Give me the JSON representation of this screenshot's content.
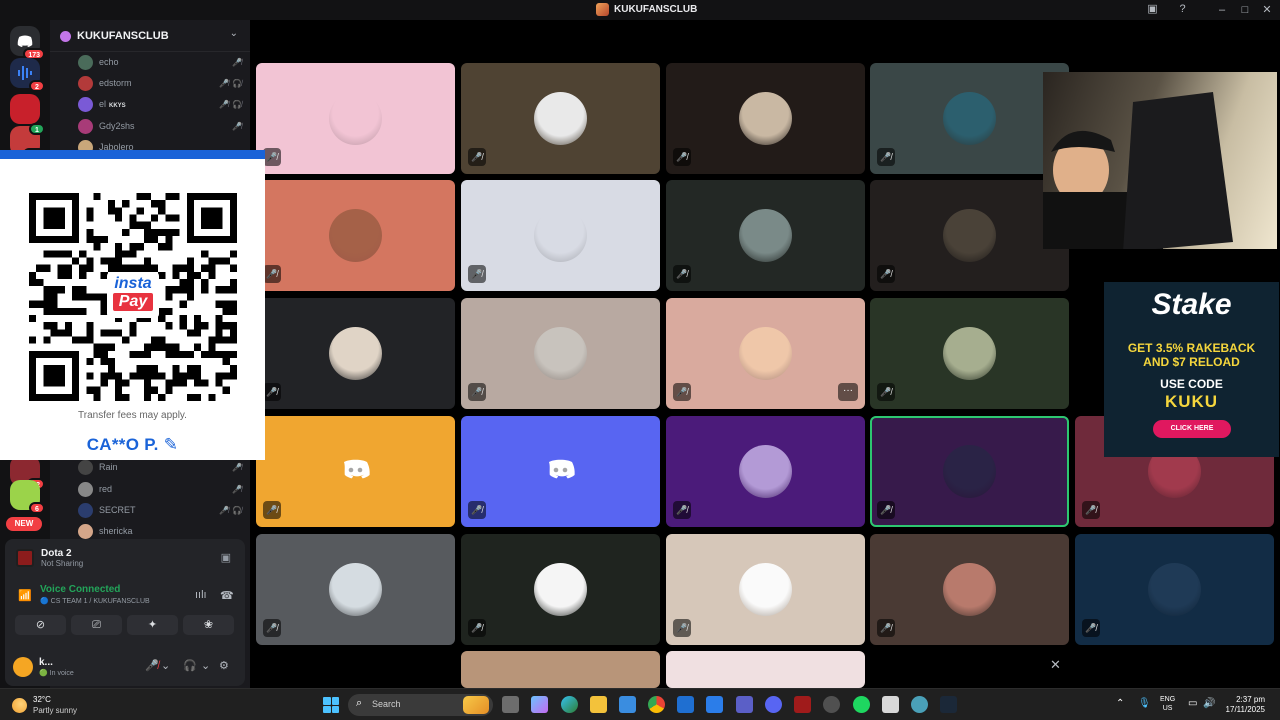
{
  "window": {
    "title": "KUKUFANSCLUB"
  },
  "rail": {
    "badges": [
      "173",
      "2",
      "1",
      "328",
      "92",
      "6"
    ],
    "new_label": "NEW"
  },
  "server": {
    "name": "KUKUFANSCLUB"
  },
  "voice_users_top": [
    {
      "name": "echo",
      "color": "#4a6b5a"
    },
    {
      "name": "edstorm",
      "color": "#b33a3a"
    },
    {
      "name": "el",
      "color": "#7a5ad6",
      "tag": "KKYS"
    },
    {
      "name": "Gdy2shs",
      "color": "#a83b78"
    },
    {
      "name": "Jabolero",
      "color": "#c9a77a"
    }
  ],
  "voice_users_bottom": [
    {
      "name": "Rain",
      "color": "#444"
    },
    {
      "name": "red",
      "color": "#888"
    },
    {
      "name": "SECRET",
      "color": "#2b3d6e"
    },
    {
      "name": "shericka",
      "color": "#d5a689"
    }
  ],
  "qr_card": {
    "logo_top": "insta",
    "logo_bottom": "Pay",
    "note": "Transfer fees may apply.",
    "recipient": "CA**O P. ✎"
  },
  "game_panel": {
    "title": "Dota 2",
    "subtitle": "Not Sharing",
    "voice_status": "Voice Connected",
    "voice_channel": "🔵 CS TEAM 1 / KUKUFANSCLUB"
  },
  "user_panel": {
    "name": "k...",
    "status": "🟢 In voice"
  },
  "tiles": [
    {
      "bg": "#f2c4d4",
      "av": "#f2c4d4"
    },
    {
      "bg": "#4f4333",
      "av": "#e9e9e9"
    },
    {
      "bg": "#221b18",
      "av": "#c9b8a3"
    },
    {
      "bg": "#3a4747",
      "av": "#2c5f6e"
    },
    {
      "bg": "#d47660",
      "av": "#a56148"
    },
    {
      "bg": "#d8dbe4",
      "av": "#d8dbe4"
    },
    {
      "bg": "#232825",
      "av": "#7a8a88"
    },
    {
      "bg": "#231f1e",
      "av": "#4a4238"
    },
    {
      "bg": "#222326",
      "av": "#e0d4c6"
    },
    {
      "bg": "#b8a9a1",
      "av": "#c8c3bd"
    },
    {
      "bg": "#d9aa9e",
      "av": "#efc7a9"
    },
    {
      "bg": "#293526",
      "av": "#a6ae8f"
    },
    {
      "bg": "#f0a630",
      "av": "#f0a630",
      "discord": true
    },
    {
      "bg": "#5865f2",
      "av": "#5865f2",
      "discord": true
    },
    {
      "bg": "#4b1b7a",
      "av": "#b39ad6"
    },
    {
      "bg": "#371a4b",
      "av": "#2a2346",
      "speaking": true
    },
    {
      "bg": "#6f2a3b",
      "av": "#a13a4d"
    },
    {
      "bg": "#575a5e",
      "av": "#d5dce1"
    },
    {
      "bg": "#1f241f",
      "av": "#f5f5f5"
    },
    {
      "bg": "#d6c7b9",
      "av": "#fafafa"
    },
    {
      "bg": "#4a3a34",
      "av": "#b87a6c"
    },
    {
      "bg": "#122c45",
      "av": "#1f3a56"
    }
  ],
  "ad": {
    "brand": "Stake",
    "line1": "GET 3.5% RAKEBACK",
    "line2": "AND $7 RELOAD",
    "line3": "USE CODE",
    "code": "KUKU",
    "cta": "CLICK HERE"
  },
  "taskbar": {
    "temperature": "32°C",
    "weather": "Partly sunny",
    "search_placeholder": "Search",
    "lang_top": "ENG",
    "lang_bottom": "US",
    "time": "2:37 pm",
    "date": "17/11/2025"
  }
}
